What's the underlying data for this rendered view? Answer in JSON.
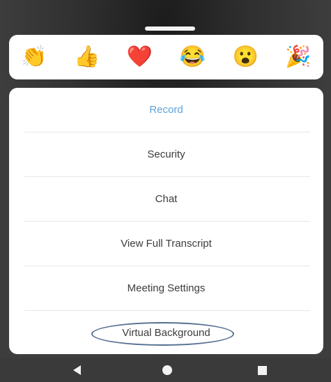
{
  "reactions": [
    {
      "icon": "clapping-hands-icon",
      "glyph": "👏"
    },
    {
      "icon": "thumbs-up-icon",
      "glyph": "👍"
    },
    {
      "icon": "red-heart-icon",
      "glyph": "❤️"
    },
    {
      "icon": "tears-of-joy-icon",
      "glyph": "😂"
    },
    {
      "icon": "surprised-face-icon",
      "glyph": "😮"
    },
    {
      "icon": "party-popper-icon",
      "glyph": "🎉"
    }
  ],
  "menu": {
    "record": "Record",
    "security": "Security",
    "chat": "Chat",
    "view_full_transcript": "View Full Transcript",
    "meeting_settings": "Meeting Settings",
    "virtual_background": "Virtual Background"
  },
  "nav": {
    "back_icon": "back-triangle-icon",
    "home_icon": "home-circle-icon",
    "recents_icon": "recents-square-icon"
  },
  "colors": {
    "accent": "#5fa2d8",
    "highlight_ring": "#55708f"
  }
}
